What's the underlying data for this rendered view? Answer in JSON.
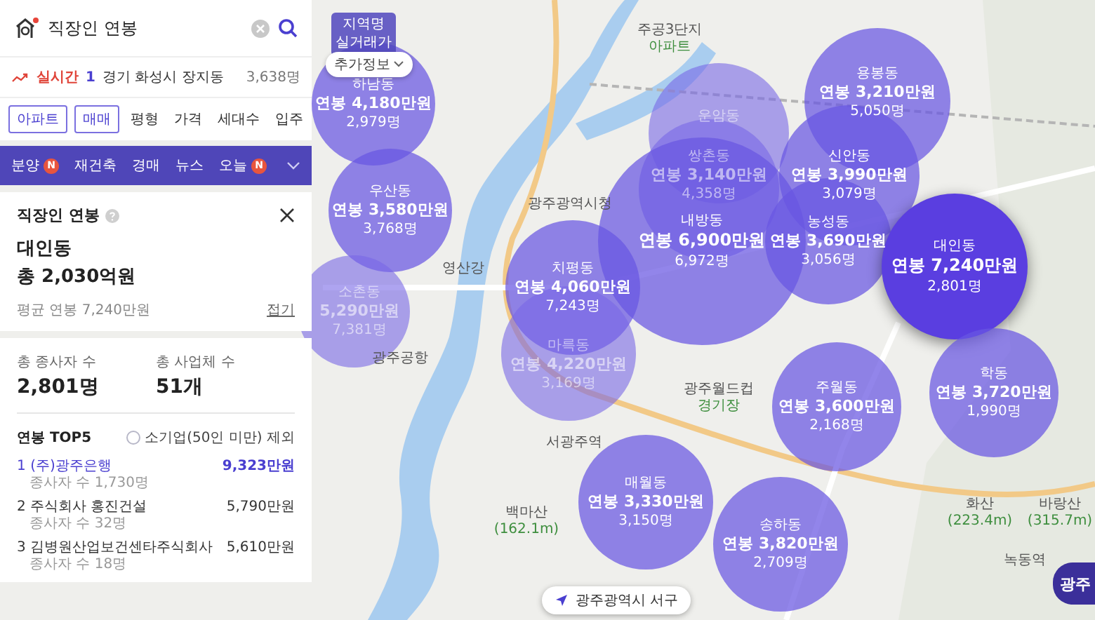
{
  "search": {
    "value": "직장인 연봉"
  },
  "realtime": {
    "label": "실시간",
    "rank": "1",
    "place": "경기 화성시 장지동",
    "count": "3,638명"
  },
  "filters": [
    {
      "label": "아파트",
      "selected": true
    },
    {
      "label": "매매",
      "selected": true
    },
    {
      "label": "평형",
      "selected": false
    },
    {
      "label": "가격",
      "selected": false
    },
    {
      "label": "세대수",
      "selected": false
    },
    {
      "label": "입주",
      "selected": false
    }
  ],
  "nav": [
    {
      "label": "분양",
      "badge": "N"
    },
    {
      "label": "재건축"
    },
    {
      "label": "경매"
    },
    {
      "label": "뉴스"
    },
    {
      "label": "오늘",
      "badge": "N"
    }
  ],
  "info_card": {
    "title": "직장인 연봉",
    "district": "대인동",
    "total": "총 2,030억원",
    "average": "평균 연봉 7,240만원",
    "collapse": "접기"
  },
  "stats": {
    "items": [
      {
        "label": "총 종사자 수",
        "value": "2,801명"
      },
      {
        "label": "총 사업체 수",
        "value": "51개"
      }
    ],
    "top_title": "연봉 TOP5",
    "exclude_small": {
      "label": "소기업(50인 미만) 제외",
      "checked": false
    },
    "companies": [
      {
        "rank": "1",
        "name": "(주)광주은행",
        "staff": "종사자 수 1,730명",
        "salary": "9,323만원",
        "selected": true
      },
      {
        "rank": "2",
        "name": "주식회사 홍진건설",
        "staff": "종사자 수 32명",
        "salary": "5,790만원",
        "selected": false
      },
      {
        "rank": "3",
        "name": "김병원산업보건센타주식회사",
        "staff": "종사자 수 18명",
        "salary": "5,610만원",
        "selected": false
      }
    ]
  },
  "map": {
    "layer_toggle": {
      "line_1": "지역명",
      "line_2": "실거래가"
    },
    "extra_info": "추가정보",
    "labels": [
      {
        "text": "주공3단지",
        "sub": "아파트"
      },
      {
        "text": "광주광역시청"
      },
      {
        "text": "영산강"
      },
      {
        "text": "광주공항"
      },
      {
        "text": "서광주역"
      },
      {
        "text": "백마산",
        "sub": "(162.1m)"
      },
      {
        "text": "광주월드컵",
        "sub": "경기장"
      },
      {
        "text": "화산",
        "sub": "(223.4m)"
      },
      {
        "text": "바랑산",
        "sub": "(315.7m)"
      },
      {
        "text": "녹동역"
      }
    ],
    "districts": [
      {
        "name": "하남동",
        "salary": "연봉 4,180만원",
        "count": "2,979명",
        "faded": false,
        "selected": false
      },
      {
        "name": "우산동",
        "salary": "연봉 3,580만원",
        "count": "3,768명",
        "faded": false,
        "selected": false
      },
      {
        "name": "소촌동",
        "salary": "5,290만원",
        "count": "7,381명",
        "faded": true,
        "selected": false
      },
      {
        "name": "치평동",
        "salary": "연봉 4,060만원",
        "count": "7,243명",
        "faded": false,
        "selected": false
      },
      {
        "name": "마륵동",
        "salary": "연봉 4,220만원",
        "count": "3,169명",
        "faded": true,
        "selected": false
      },
      {
        "name": "운암동",
        "faded": true,
        "selected": false
      },
      {
        "name": "쌍촌동",
        "salary": "연봉 3,140만원",
        "count": "4,358명",
        "faded": true,
        "selected": false
      },
      {
        "name": "용봉동",
        "salary": "연봉 3,210만원",
        "count": "5,050명",
        "faded": false,
        "selected": false
      },
      {
        "name": "신안동",
        "salary": "연봉 3,990만원",
        "count": "3,079명",
        "faded": false,
        "selected": false
      },
      {
        "name": "내방동",
        "salary": "연봉 6,900만원",
        "count": "6,972명",
        "faded": false,
        "selected": false
      },
      {
        "name": "농성동",
        "salary": "연봉 3,690만원",
        "count": "3,056명",
        "faded": false,
        "selected": false
      },
      {
        "name": "대인동",
        "salary": "연봉 7,240만원",
        "count": "2,801명",
        "faded": false,
        "selected": true
      },
      {
        "name": "주월동",
        "salary": "연봉 3,600만원",
        "count": "2,168명",
        "faded": false,
        "selected": false
      },
      {
        "name": "학동",
        "salary": "연봉 3,720만원",
        "count": "1,990명",
        "faded": false,
        "selected": false
      },
      {
        "name": "매월동",
        "salary": "연봉 3,330만원",
        "count": "3,150명",
        "faded": false,
        "selected": false
      },
      {
        "name": "송하동",
        "salary": "연봉 3,820만원",
        "count": "2,709명",
        "faded": false,
        "selected": false
      }
    ],
    "location": "광주광역시 서구",
    "side_button": "광주"
  }
}
